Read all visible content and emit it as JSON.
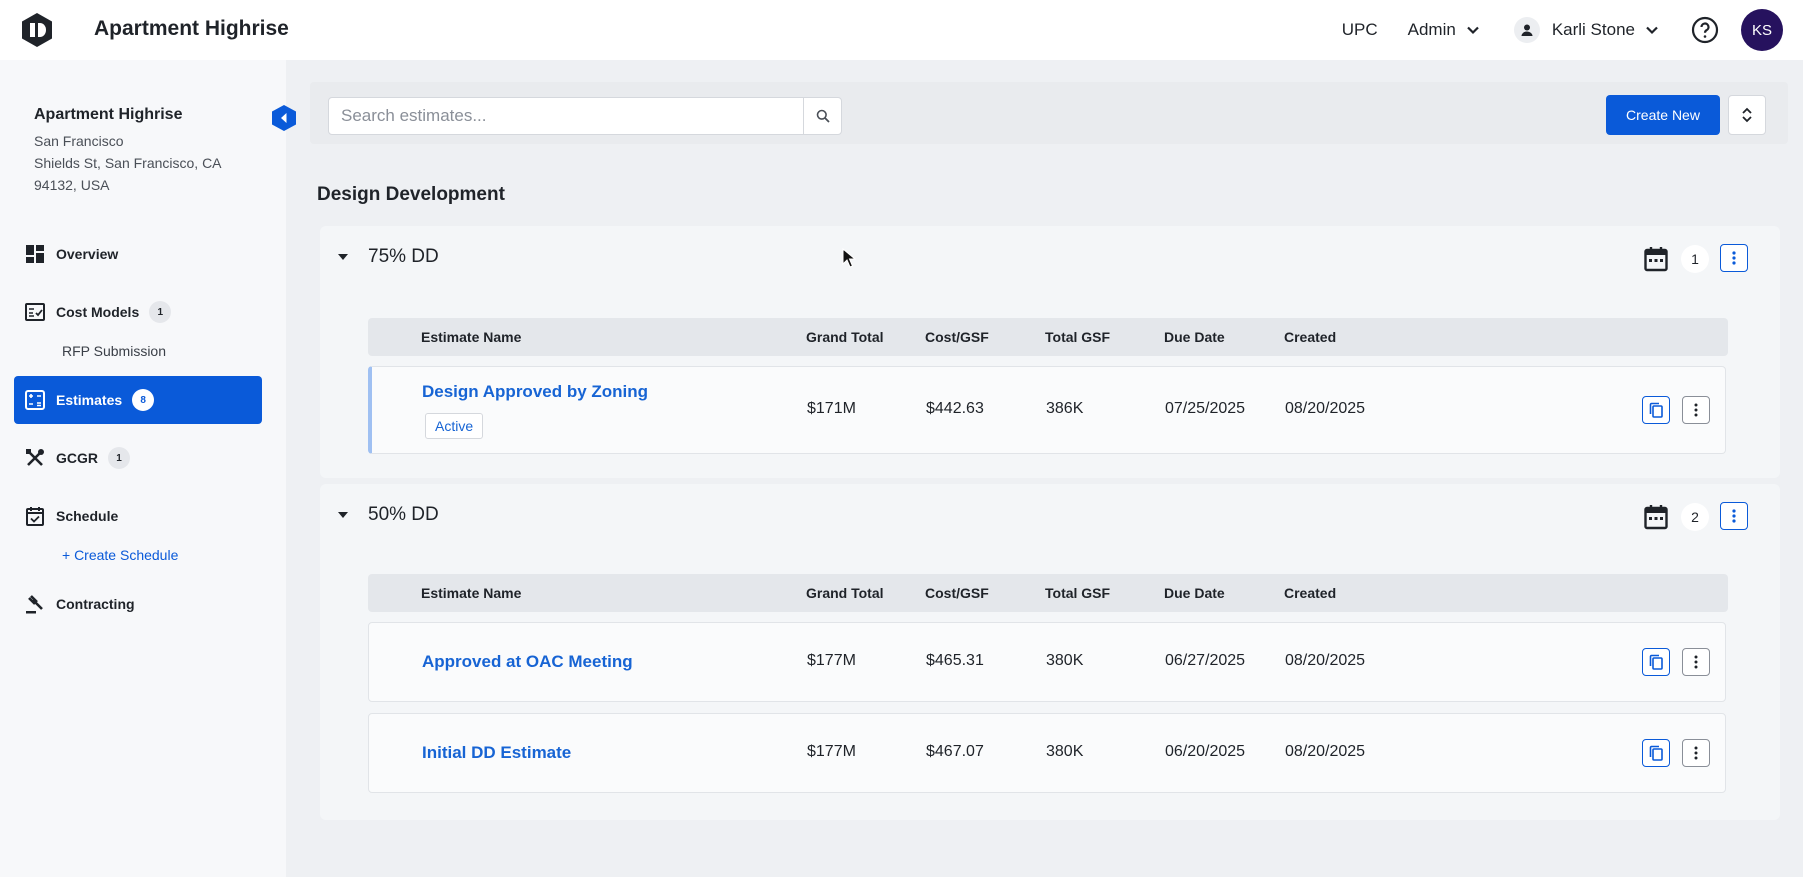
{
  "header": {
    "app_title": "Apartment Highrise",
    "upc": "UPC",
    "admin": "Admin",
    "user_name": "Karli Stone",
    "avatar_initials": "KS"
  },
  "sidebar": {
    "project_name": "Apartment Highrise",
    "address_lines": [
      "San Francisco",
      "Shields St, San Francisco, CA",
      "94132, USA"
    ],
    "items": [
      {
        "label": "Overview",
        "icon": "dashboard-icon"
      },
      {
        "label": "Cost Models",
        "badge": "1",
        "icon": "checklist-icon"
      },
      {
        "sub_label": "RFP Submission"
      },
      {
        "label": "Estimates",
        "badge": "8",
        "icon": "calculator-icon",
        "active": true
      },
      {
        "label": "GCGR",
        "badge": "1",
        "icon": "tools-icon"
      },
      {
        "label": "Schedule",
        "icon": "calendar-check-icon"
      },
      {
        "sub_label": "+ Create Schedule"
      },
      {
        "label": "Contracting",
        "icon": "gavel-icon"
      }
    ]
  },
  "toolbar": {
    "search_placeholder": "Search estimates...",
    "create_label": "Create New"
  },
  "section_title": "Design Development",
  "columns": [
    "Estimate Name",
    "Grand Total",
    "Cost/GSF",
    "Total GSF",
    "Due Date",
    "Created"
  ],
  "groups": [
    {
      "name": "75% DD",
      "count": "1",
      "rows": [
        {
          "name": "Design Approved by Zoning",
          "status": "Active",
          "grand_total": "$171M",
          "cost_gsf": "$442.63",
          "total_gsf": "386K",
          "due_date": "07/25/2025",
          "created": "08/20/2025"
        }
      ]
    },
    {
      "name": "50% DD",
      "count": "2",
      "rows": [
        {
          "name": "Approved at OAC Meeting",
          "grand_total": "$177M",
          "cost_gsf": "$465.31",
          "total_gsf": "380K",
          "due_date": "06/27/2025",
          "created": "08/20/2025"
        },
        {
          "name": "Initial DD Estimate",
          "grand_total": "$177M",
          "cost_gsf": "$467.07",
          "total_gsf": "380K",
          "due_date": "06/20/2025",
          "created": "08/20/2025"
        }
      ]
    }
  ],
  "colors": {
    "accent": "#0a5ad9",
    "avatar": "#26125e",
    "link": "#1764d4"
  }
}
